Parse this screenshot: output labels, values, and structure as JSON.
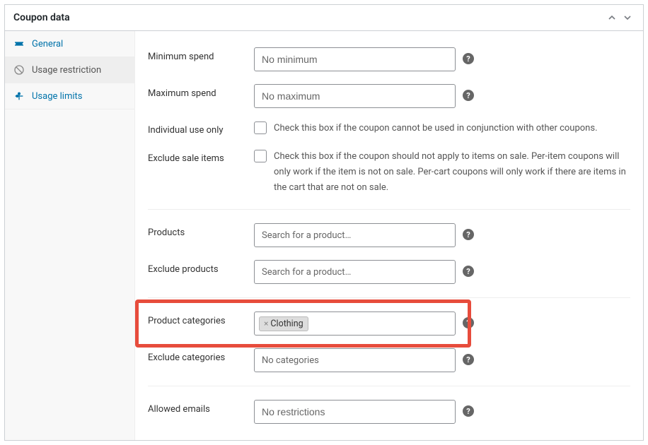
{
  "header": {
    "title": "Coupon data"
  },
  "sidebar": {
    "items": [
      {
        "label": "General"
      },
      {
        "label": "Usage restriction"
      },
      {
        "label": "Usage limits"
      }
    ]
  },
  "fields": {
    "min_spend": {
      "label": "Minimum spend",
      "placeholder": "No minimum"
    },
    "max_spend": {
      "label": "Maximum spend",
      "placeholder": "No maximum"
    },
    "individual": {
      "label": "Individual use only",
      "desc": "Check this box if the coupon cannot be used in conjunction with other coupons."
    },
    "exclude_sale": {
      "label": "Exclude sale items",
      "desc": "Check this box if the coupon should not apply to items on sale. Per-item coupons will only work if the item is not on sale. Per-cart coupons will only work if there are items in the cart that are not on sale."
    },
    "products": {
      "label": "Products",
      "placeholder": "Search for a product…"
    },
    "exclude_products": {
      "label": "Exclude products",
      "placeholder": "Search for a product…"
    },
    "product_categories": {
      "label": "Product categories",
      "tags": [
        "Clothing"
      ]
    },
    "exclude_categories": {
      "label": "Exclude categories",
      "placeholder": "No categories"
    },
    "allowed_emails": {
      "label": "Allowed emails",
      "placeholder": "No restrictions"
    }
  },
  "help": "?"
}
